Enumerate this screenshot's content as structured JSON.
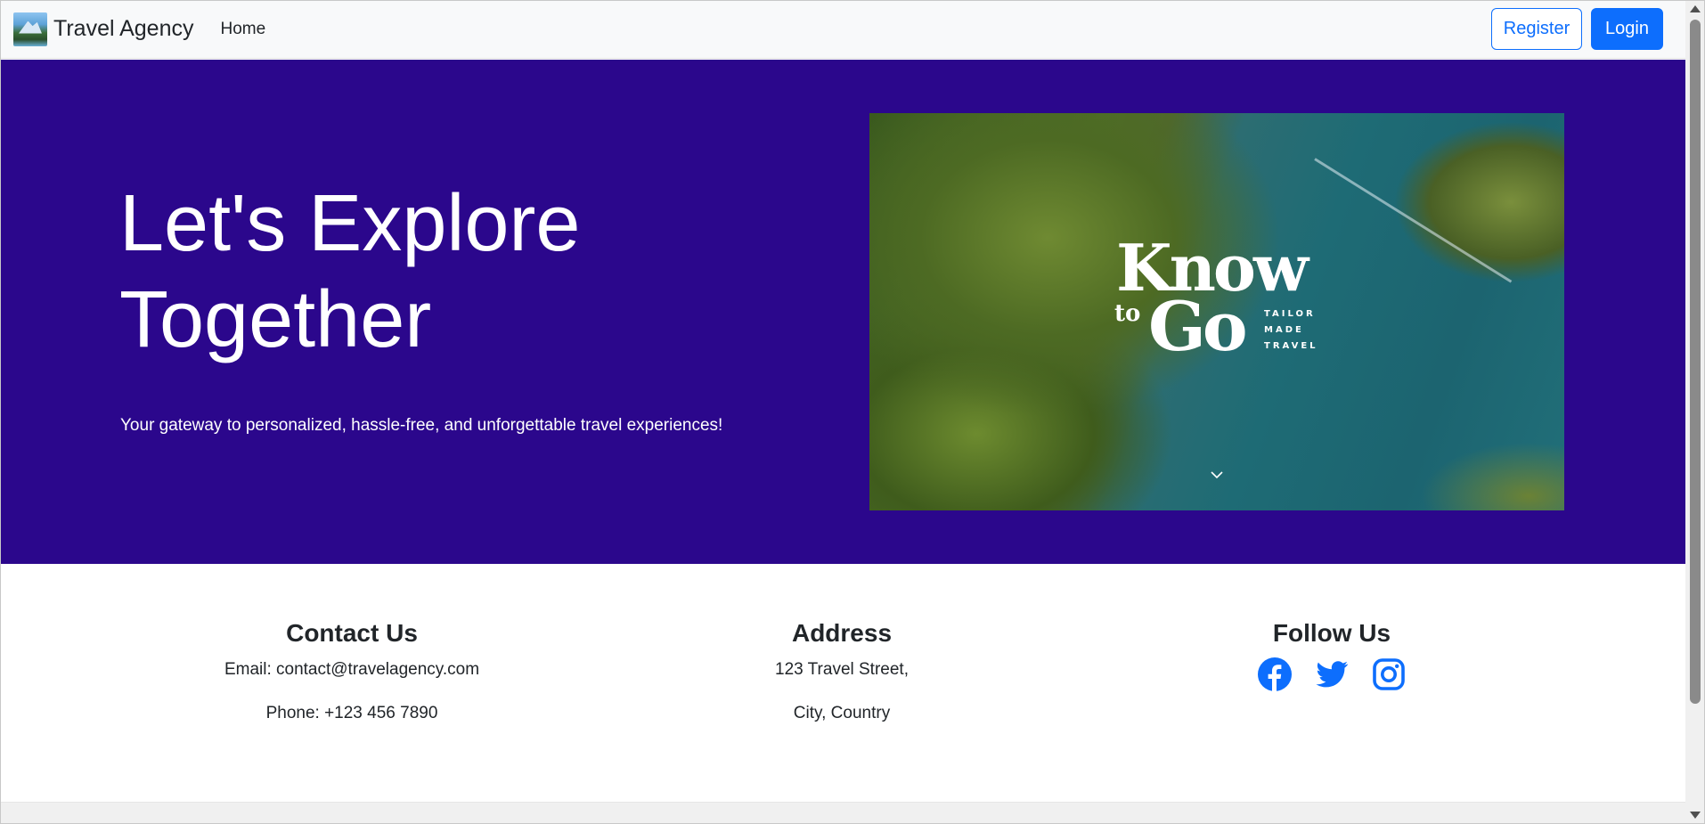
{
  "navbar": {
    "brand_text": "Travel Agency",
    "home_label": "Home",
    "register_label": "Register",
    "login_label": "Login"
  },
  "hero": {
    "title_line1": "Let's Explore",
    "title_line2": "Together",
    "subtitle": "Your gateway to personalized, hassle-free, and unforgettable travel experiences!",
    "image_logo": {
      "word1": "Know",
      "word2": "to",
      "word3": "Go",
      "tag_line1": "TAILOR",
      "tag_line2": "MADE",
      "tag_line3": "TRAVEL"
    }
  },
  "footer": {
    "contact": {
      "heading": "Contact Us",
      "email": "Email: contact@travelagency.com",
      "phone": "Phone: +123 456 7890"
    },
    "address": {
      "heading": "Address",
      "line1": "123 Travel Street,",
      "line2": "City, Country"
    },
    "follow": {
      "heading": "Follow Us",
      "icons": [
        "facebook-icon",
        "twitter-icon",
        "instagram-icon"
      ]
    }
  },
  "colors": {
    "hero_bg": "#2b078c",
    "primary": "#0d6efd",
    "navbar_bg": "#f8f9fa"
  }
}
